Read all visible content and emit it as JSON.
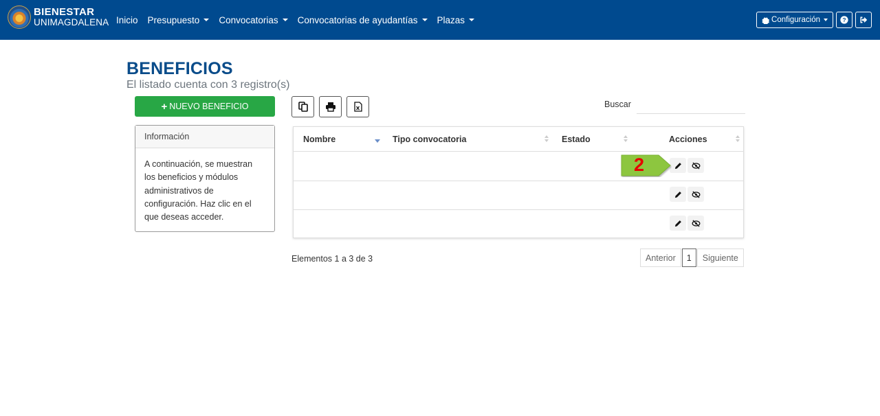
{
  "brand": {
    "line1": "BIENESTAR",
    "line2": "UNIMAGDALENA"
  },
  "nav": {
    "items": [
      {
        "label": "Inicio",
        "dropdown": false
      },
      {
        "label": "Presupuesto",
        "dropdown": true
      },
      {
        "label": "Convocatorias",
        "dropdown": true
      },
      {
        "label": "Convocatorias de ayudantías",
        "dropdown": true
      },
      {
        "label": "Plazas",
        "dropdown": true
      }
    ],
    "config_label": "Configuración",
    "help_icon": "question-circle-icon",
    "logout_icon": "sign-out-icon"
  },
  "page": {
    "title": "BENEFICIOS",
    "subtitle": "El listado cuenta con 3 registro(s)"
  },
  "new_button_label": "NUEVO BENEFICIO",
  "info": {
    "header": "Información",
    "body": "A continuación, se muestran los beneficios y módulos administrativos de configuración. Haz clic en el que deseas acceder."
  },
  "export_buttons": [
    "copy-icon",
    "print-icon",
    "excel-icon"
  ],
  "search": {
    "label": "Buscar",
    "value": ""
  },
  "table": {
    "columns": [
      "Nombre",
      "Tipo convocatoria",
      "Estado",
      "Acciones"
    ],
    "rows": [
      {
        "nombre": "",
        "tipo": "",
        "estado": ""
      },
      {
        "nombre": "",
        "tipo": "",
        "estado": ""
      },
      {
        "nombre": "",
        "tipo": "",
        "estado": ""
      }
    ],
    "row_actions": [
      "edit-icon",
      "hide-icon"
    ]
  },
  "annotation": {
    "label": "2",
    "color": "#8dc63f",
    "text_color": "#e60000"
  },
  "footer": {
    "count_text": "Elementos 1 a 3 de 3",
    "prev_label": "Anterior",
    "current_page": "1",
    "next_label": "Siguiente"
  },
  "colors": {
    "navbar": "#004a8f",
    "title": "#0a4c8a",
    "new_button": "#28a745"
  }
}
